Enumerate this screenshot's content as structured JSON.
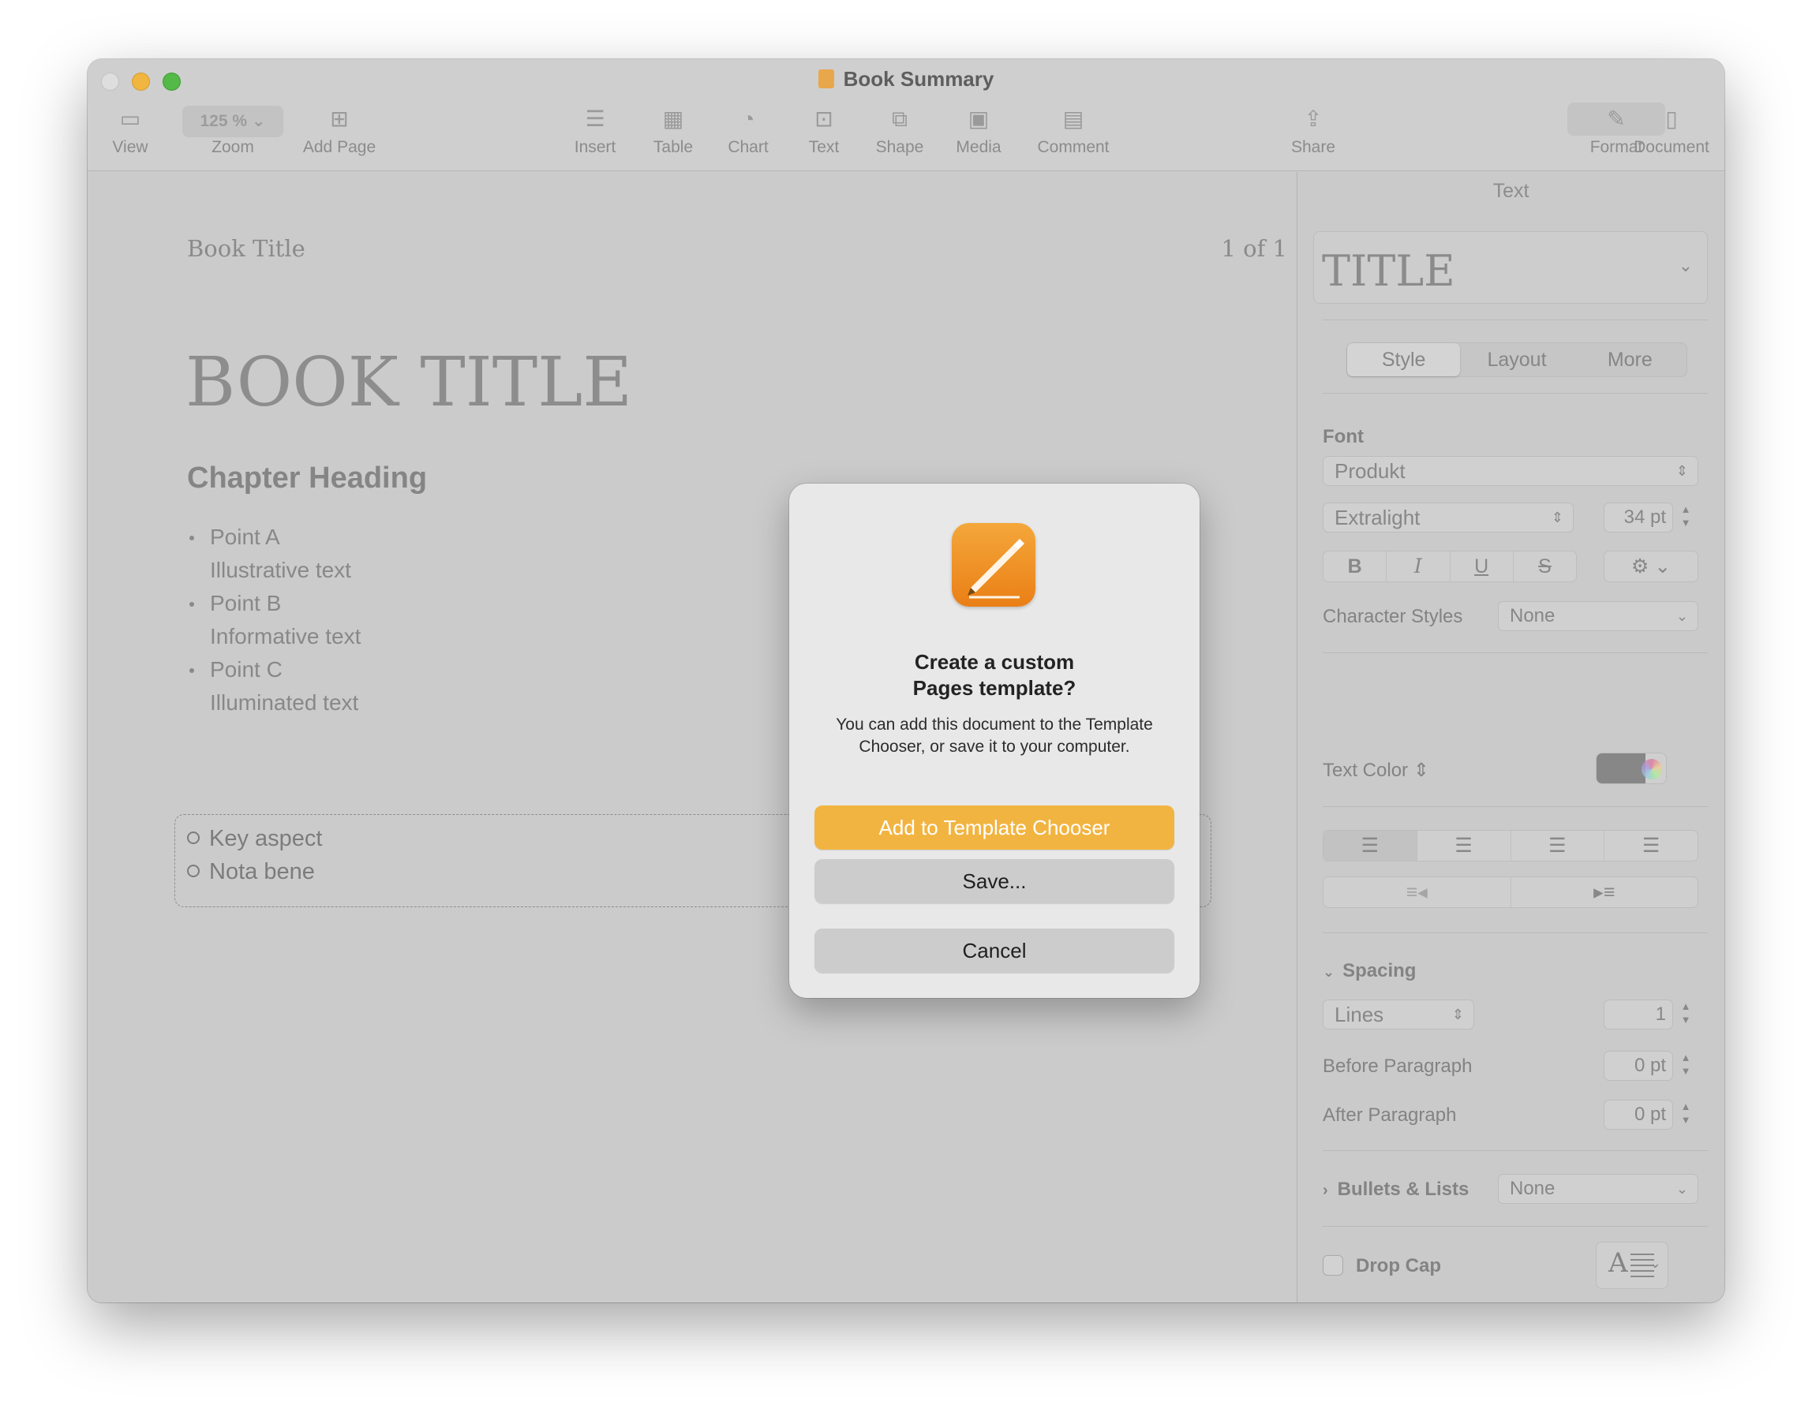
{
  "window": {
    "title": "Book Summary"
  },
  "toolbar": {
    "view": "View",
    "zoom_value": "125 %",
    "zoom": "Zoom",
    "add_page": "Add Page",
    "insert": "Insert",
    "table": "Table",
    "chart": "Chart",
    "text": "Text",
    "shape": "Shape",
    "media": "Media",
    "comment": "Comment",
    "share": "Share",
    "format": "Format",
    "document": "Document"
  },
  "document": {
    "header_title": "Book Title",
    "page_indicator": "1 of 1",
    "book_title": "BOOK TITLE",
    "chapter_heading": "Chapter Heading",
    "points": [
      {
        "label": "Point A",
        "detail": "Illustrative text"
      },
      {
        "label": "Point B",
        "detail": "Informative text"
      },
      {
        "label": "Point C",
        "detail": "Illuminated text"
      }
    ],
    "key_items": [
      "Key aspect",
      "Nota bene"
    ]
  },
  "inspector": {
    "header": "Text",
    "paragraph_style": "TITLE",
    "tabs": [
      "Style",
      "Layout",
      "More"
    ],
    "font_label": "Font",
    "font_family": "Produkt",
    "font_weight": "Extralight",
    "font_size": "34 pt",
    "format_buttons": [
      "B",
      "I",
      "U",
      "S"
    ],
    "character_styles_label": "Character Styles",
    "character_styles_value": "None",
    "text_color_label": "Text Color",
    "text_color": "#878787",
    "spacing_label": "Spacing",
    "spacing_mode": "Lines",
    "spacing_value": "1",
    "before_paragraph_label": "Before Paragraph",
    "before_paragraph_value": "0 pt",
    "after_paragraph_label": "After Paragraph",
    "after_paragraph_value": "0 pt",
    "bullets_label": "Bullets & Lists",
    "bullets_value": "None",
    "drop_cap_label": "Drop Cap",
    "drop_cap_glyph": "A"
  },
  "dialog": {
    "title_line1": "Create a custom",
    "title_line2": "Pages template?",
    "message": "You can add this document to the Template Chooser, or save it to your computer.",
    "primary_button": "Add to Template Chooser",
    "save_button": "Save...",
    "cancel_button": "Cancel",
    "accent_color": "#f2b441"
  }
}
